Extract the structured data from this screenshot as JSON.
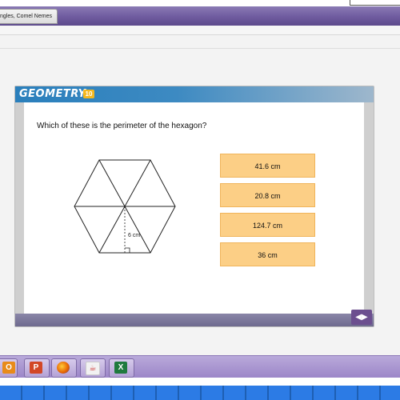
{
  "window": {
    "tab_title": "ngles, Comel Nemes"
  },
  "quiz": {
    "brand": "GEOMETRY",
    "brand_badge": "10",
    "question": "Which of these is the perimeter of the hexagon?",
    "figure": {
      "shape": "regular hexagon divided into 6 triangles",
      "label": "6 cm"
    },
    "answers": [
      "41.6 cm",
      "20.8 cm",
      "124.7 cm",
      "36 cm"
    ],
    "nav_icon": "left-right-arrows-icon"
  },
  "taskbar": {
    "icons": [
      "outlook-icon",
      "powerpoint-icon",
      "firefox-icon",
      "java-icon",
      "excel-icon"
    ]
  },
  "colors": {
    "title_bar": "#6f5b9f",
    "header_blue": "#2a7fbc",
    "answer_fill": "#fccf86",
    "nav_purple": "#6c4f8f",
    "taskbar": "#9c86c8",
    "bottom_bar": "#2c7be5"
  }
}
